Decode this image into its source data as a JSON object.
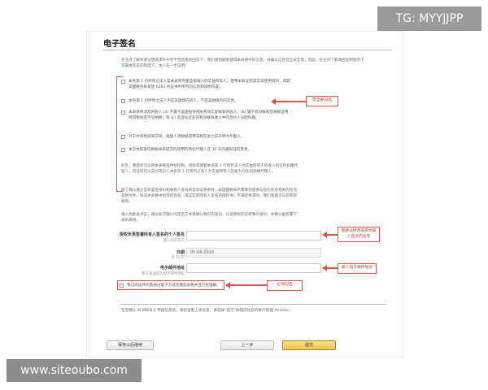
{
  "watermarks": {
    "top": "TG: MYYJJPP",
    "bottom": "www.siteoubo.com"
  },
  "form": {
    "title": "电子签名",
    "intro": "在允许了解和获证明请求声中签不包括更的回答下，我们受伪期限使得本表格中的信息，并确认信息在正式实现。因此，在允许了解请回证明程序下签属本签名的程度下，本人在一步证明：",
    "checkboxes": [
      {
        "label": "本条第 1 行所列之法人是本表所列使全部收入的实益所有人，使用本表证明其实际使用目的，或其美国税务局发放 6363 的证书中所列的信息和说明内容。"
      },
      {
        "label": "本条第 1 行所列之法人不是美国境内的人，不是美国境内的实体。"
      },
      {
        "label": "本表单所涉及的收入 (a) 不属于美国投资相关有效实际联系的收入；(b) 属于有效联系但根据适用所得税协定不应纳税；或 (c) 是合伙企业的有效联系收入中的合伙人分配份额。"
      },
      {
        "label": "对于中间经纪商交易，收益人须根据适用法规在此之前声明为外国人。"
      },
      {
        "label": "本实体同意向根据本表提交的适用的预扣代理人在 30 天内通知任何变更。"
      }
    ],
    "para1": "此外，我授权可以将本表格提供给控制、接收或保管本表第 1 行所列法人为实益所有人的收入的任何扣缴代理人，或任何可以支付或记入本表第 1 行所列之法人为实益所有人的收入的任何扣缴代理人。",
    "para2": "除了确认确立您非美国身份和纳税人身份的自动证明条件，美国国税局不需要您提供与您的身份相关的任何其他文件，除非本表格中出现的签名（或是实际所有人签名的授权书）不满足要求时，我们会再次与您取得联系。",
    "para3": "请入到此处点击，通过此次确认的签名方式来确认我们的身份，以证明您的证明我的身份，并确认由签署下表的表格。",
    "fields": {
      "signer_label": "授权负责签署所有人签名的个人签名",
      "signer_sub": "输入您的签名",
      "date_label": "日期",
      "date_value": "05-06-2016",
      "date_sub": "月-日-年",
      "email_label": "电子邮件地址",
      "email_sub": "用于发送您的电子邮件地址"
    },
    "confirm_checkbox": "我已阅读并同意通过电子方式签署此表格并且已经理解。",
    "footer_text": "在您确认 W-8BEN-E 申报信息前，请您查看上述信息，请选择“提交”按钮前往您的帐户管理 Amazon。",
    "buttons": {
      "save_later": "保存以后继续",
      "back": "上一步",
      "submit": "提交"
    }
  },
  "callouts": {
    "select_all": "需全部勾选",
    "english_name": "需要以拼音或英文输入签名的名字",
    "email": "输入电子邮件地址",
    "consent": "必须勾选"
  },
  "colors": {
    "annotation": "#d9534f",
    "submit_button": "#f0c14b"
  }
}
